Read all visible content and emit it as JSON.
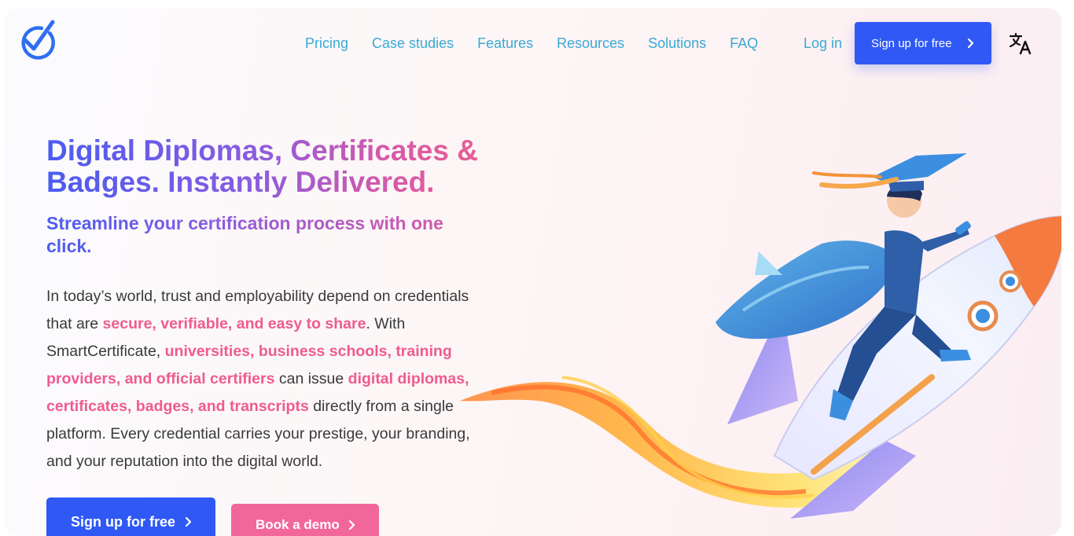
{
  "header": {
    "logo_icon": "checkmark-logo-icon",
    "nav": [
      {
        "label": "Pricing"
      },
      {
        "label": "Case studies"
      },
      {
        "label": "Features"
      },
      {
        "label": "Resources"
      },
      {
        "label": "Solutions"
      },
      {
        "label": "FAQ"
      }
    ],
    "login_label": "Log in",
    "cta_label": "Sign up for free",
    "language_icon": "translate-icon"
  },
  "hero": {
    "title": "Digital Diplomas, Certificates & Badges. Instantly Delivered.",
    "subtitle": "Streamline your certification process with one click.",
    "body": {
      "p1": "In today’s world, trust and employability depend on credentials that are ",
      "h1": "secure, verifiable, and easy to share",
      "p2": ". With SmartCertificate, ",
      "h2": "universities, business schools, training providers, and official certifiers",
      "p3": " can issue ",
      "h3": "digital diplomas, certificates, badges, and transcripts",
      "p4": " directly from a single platform. Every credential carries your prestige, your branding, and your reputation into the digital world."
    },
    "primary_cta": "Sign up for free",
    "secondary_cta": "Book a demo"
  },
  "colors": {
    "brand_blue": "#2f58f5",
    "link_blue": "#39a9d4",
    "accent_pink": "#ef5b8f",
    "button_pink": "#f2679a"
  },
  "illustration": "graduate-riding-rocket-illustration"
}
